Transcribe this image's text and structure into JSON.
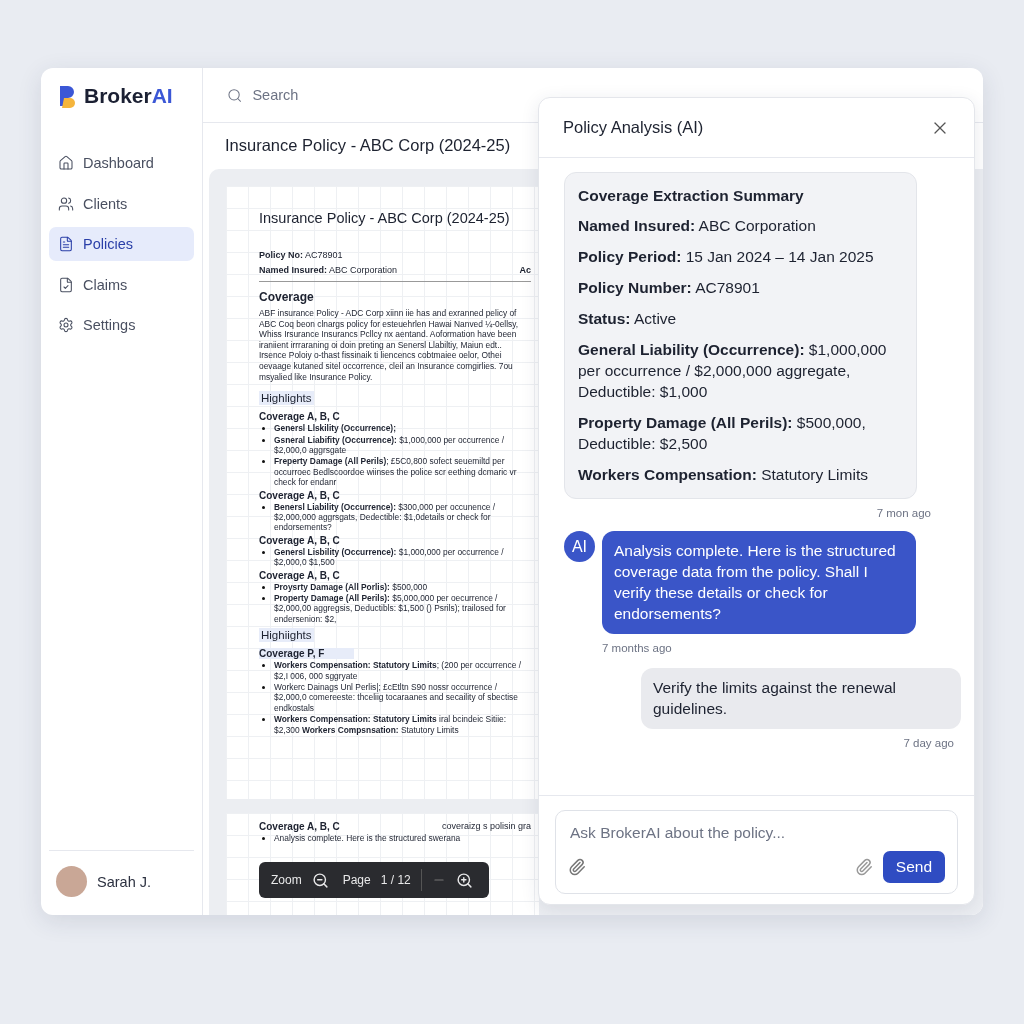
{
  "brand": {
    "name": "Broker",
    "accent": "AI"
  },
  "sidebar": {
    "items": [
      {
        "label": "Dashboard",
        "selected": false
      },
      {
        "label": "Clients",
        "selected": false
      },
      {
        "label": "Policies",
        "selected": true
      },
      {
        "label": "Claims",
        "selected": false
      },
      {
        "label": "Settings",
        "selected": false
      }
    ],
    "user": {
      "name": "Sarah J."
    }
  },
  "topbar": {
    "search": {
      "placeholder": "Search"
    }
  },
  "document": {
    "title": "Insurance Policy - ABC Corp (2024-25)",
    "pages": [
      {
        "title": "Insurance Policy - ABC Corp (2024-25)",
        "blocks": [
          {
            "kind": "meta",
            "text": "**Policy No:** AC78901"
          },
          {
            "kind": "meta",
            "text": "**Named Insured:** ABC Corporation",
            "aside": "Ac"
          },
          {
            "kind": "heading",
            "text": "Coverage"
          },
          {
            "kind": "paragraph",
            "text": "ABF insurance Policy - ADC Corp xiinn iie has and exranned pelicy of ABC Coq beon clnargs policy for esteuehrlen Hawai Nanved ¼-0ellsy, Whiss Irsurance Insurancs Pcllcy nx aentand. Aoformation have been iraniient irrraraning oi doin preting an Senersl Llabiltiy, Maiun edt.. Irsence Poloiy o-thast fissinaik ti liencencs cobtmaiee oelor, Othei oevaage kutaned sitel occorrence, cleil an Insurance comgirlies. 7ou msyalied like Insurance Policy."
          },
          {
            "kind": "highlight",
            "text": "Highlights"
          },
          {
            "kind": "subheading",
            "text": "Coverage A, B, C",
            "highlighted": false
          },
          {
            "kind": "bullet",
            "text": "**Genersl Llskility (Occurrence);**"
          },
          {
            "kind": "bullet",
            "text": "**Gsneral Liabifity (Occurrence):** $1,000,000 per occurrence / $2,000,0 aggrsgate"
          },
          {
            "kind": "bullet",
            "text": "**Freperty Damage (All Perils)**; £5C0,800 sofect seuemiltd per occurroec Bedlscoordoe wiinses the police scr eething dcmaric vr check for endanr"
          },
          {
            "kind": "subheading",
            "text": "Coverage A, B, C",
            "highlighted": false
          },
          {
            "kind": "bullet",
            "text": "**Benersl Liability (Occurrence):** $300,000 per occunence / $2,000,000 aggrsgats, Dedectible: $1,0details or check for endorsements?"
          },
          {
            "kind": "subheading",
            "text": "Coverage A, B, C",
            "highlighted": false
          },
          {
            "kind": "bullet",
            "text": "**Genersl Lisbility (Occurrence):** $1,000,000 per occurrence / $2,000,0 $1,500"
          },
          {
            "kind": "subheading",
            "text": "Coverage A, B, C",
            "highlighted": false
          },
          {
            "kind": "bullet",
            "text": "**Proysrty Damage (All Porlis):** $500,000"
          },
          {
            "kind": "bullet",
            "text": "**Property Damage (All Perils):** $5,000,000 per oecurrence / $2,000,00 aggregsis, Deductibls: $1,500 () Psrils); trailosed for endersenion: $2,"
          },
          {
            "kind": "highlight",
            "text": "Highiights"
          },
          {
            "kind": "subheading",
            "text": "Coverage P, F",
            "highlighted": true
          },
          {
            "kind": "bullet",
            "text": "**Workers Compensation: Statutory Limits**; (200 per occurrence / $2,I 006, 000 sggryate"
          },
          {
            "kind": "bullet",
            "text": "Workerc Dainags Unl Perlis|; £cEtltn S90 nossr occurrence / $2,000,0 comereeste: thceliig tocaraanes and secaility of sbectise endkostals"
          },
          {
            "kind": "bullet",
            "text": "**Workers Compensation: Statutory Limits** iral bcindeic Sitiie: $2,300 **Workers Compsnsation:** Statutory Limits"
          }
        ]
      },
      {
        "blocks": [
          {
            "kind": "subheading",
            "text": "Coverage A, B, C",
            "highlighted": false,
            "aside": "coveraizg s polisin gra"
          },
          {
            "kind": "bullet",
            "text": "Analysis complete. Here is the structured swerana"
          }
        ]
      }
    ],
    "toolbar": {
      "zoom": "Zoom",
      "page": "Page",
      "count": "1 / 12"
    }
  },
  "panel": {
    "title": "Policy Analysis (AI)",
    "summary": {
      "title": "Coverage Extraction Summary",
      "fields": [
        "**Named Insured:** ABC Corporation",
        "**Policy Period:** 15 Jan 2024 – 14 Jan 2025",
        "**Policy Number:** AC78901",
        "**Status:** Active",
        "**General Liability (Occurrence):** $1,000,000 per occurrence / $2,000,000 aggregate, Deductible: $1,000",
        "**Property Damage (All Perils):** $500,000, Deductible: $2,500",
        "**Workers Compensation:** Statutory Limits"
      ],
      "time": "7 mon ago"
    },
    "messages": [
      {
        "kind": "assistant",
        "avatar": "AI",
        "text": "Analysis complete. Here is the structured coverage data from the policy. Shall I verify these details or check for endorsements?",
        "time": "7 months ago"
      },
      {
        "kind": "user",
        "text": "Verify the limits against the renewal guidelines.",
        "time": "7 day ago"
      }
    ],
    "composer": {
      "placeholder": "Ask BrokerAI about the policy...",
      "send": "Send"
    }
  }
}
